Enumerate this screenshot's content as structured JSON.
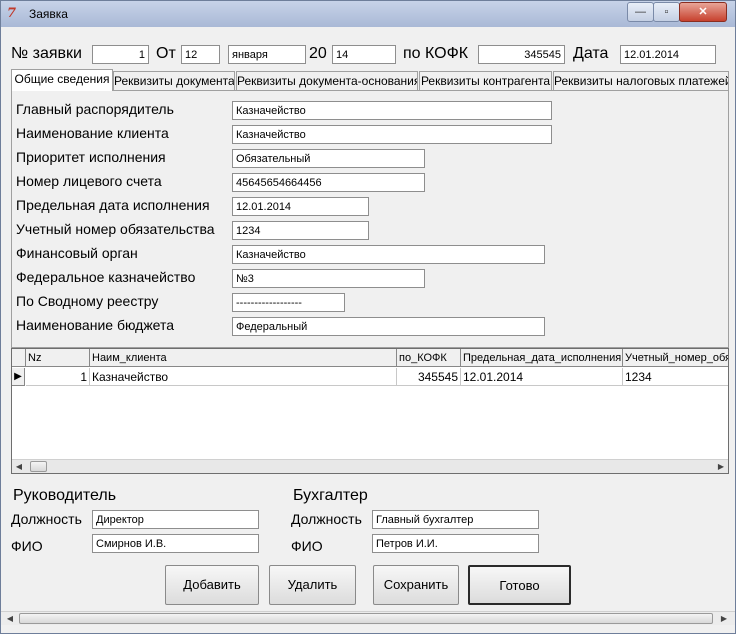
{
  "window": {
    "title": "Заявка",
    "app_icon": "7",
    "min_glyph": "—",
    "max_glyph": "▫",
    "close_glyph": "✕"
  },
  "header": {
    "order_no_label": "№ заявки",
    "order_no": "1",
    "from_label": "От",
    "day": "12",
    "month": "января",
    "year_prefix": "20",
    "year_suffix": "14",
    "kofk_label": "по КОФК",
    "kofk": "345545",
    "date_label": "Дата",
    "date": "12.01.2014"
  },
  "tabs": [
    {
      "label": "Общие сведения"
    },
    {
      "label": "Реквизиты документа"
    },
    {
      "label": "Реквизиты документа-основания"
    },
    {
      "label": "Реквизиты контрагента"
    },
    {
      "label": "Реквизиты налоговых платежей"
    }
  ],
  "form": {
    "fields": [
      {
        "label": "Главный распорядитель",
        "value": "Казначейство"
      },
      {
        "label": "Наименование клиента",
        "value": "Казначейство"
      },
      {
        "label": "Приоритет исполнения",
        "value": "Обязательный"
      },
      {
        "label": "Номер лицевого счета",
        "value": "45645654664456"
      },
      {
        "label": "Предельная дата исполнения",
        "value": "12.01.2014"
      },
      {
        "label": "Учетный номер обязательства",
        "value": "1234"
      },
      {
        "label": "Финансовый орган",
        "value": "Казначейство"
      },
      {
        "label": "Федеральное казначейство",
        "value": "№3"
      },
      {
        "label": "По Сводному реестру",
        "value": "------------------"
      },
      {
        "label": "Наименование бюджета",
        "value": "Федеральный"
      }
    ]
  },
  "grid": {
    "columns": [
      "Nz",
      "Наим_клиента",
      "по_КОФК",
      "Предельная_дата_исполнения",
      "Учетный_номер_обязательства"
    ],
    "rows": [
      {
        "cells": [
          "1",
          "Казначейство",
          "345545",
          "12.01.2014",
          "1234"
        ]
      }
    ],
    "row_indicator": "▶"
  },
  "signatures": {
    "head_title": "Руководитель",
    "head_position_label": "Должность",
    "head_position": "Директор",
    "head_name_label": "ФИО",
    "head_name": "Смирнов И.В.",
    "acc_title": "Бухгалтер",
    "acc_position_label": "Должность",
    "acc_position": "Главный бухгалтер",
    "acc_name_label": "ФИО",
    "acc_name": "Петров И.И."
  },
  "buttons": {
    "add": "Добавить",
    "delete": "Удалить",
    "save": "Сохранить",
    "done": "Готово"
  },
  "scroll": {
    "left_arrow": "◀",
    "right_arrow": "▶"
  }
}
